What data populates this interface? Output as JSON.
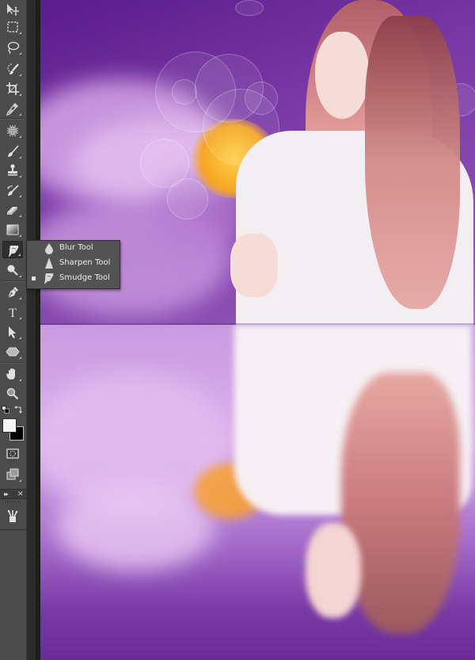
{
  "app": {
    "panel": "Tools",
    "panel_controls": {
      "collapse_glyph": "▸▸",
      "close_glyph": "✕"
    }
  },
  "tools": [
    {
      "id": "move",
      "name": "Move Tool",
      "icon": "move-icon",
      "group_more": false
    },
    {
      "id": "marquee",
      "name": "Rectangular Marquee Tool",
      "icon": "marquee-icon",
      "group_more": true
    },
    {
      "id": "lasso",
      "name": "Lasso Tool",
      "icon": "lasso-icon",
      "group_more": true
    },
    {
      "id": "quick-select",
      "name": "Quick Selection Tool",
      "icon": "quick-selection-icon",
      "group_more": true
    },
    {
      "id": "crop",
      "name": "Crop Tool",
      "icon": "crop-icon",
      "group_more": true
    },
    {
      "id": "eyedropper",
      "name": "Eyedropper Tool",
      "icon": "eyedropper-icon",
      "group_more": true
    },
    {
      "id": "healing",
      "name": "Spot Healing Brush Tool",
      "icon": "healing-brush-icon",
      "group_more": true
    },
    {
      "id": "brush",
      "name": "Brush Tool",
      "icon": "brush-icon",
      "group_more": true
    },
    {
      "id": "stamp",
      "name": "Clone Stamp Tool",
      "icon": "clone-stamp-icon",
      "group_more": true
    },
    {
      "id": "history-brush",
      "name": "History Brush Tool",
      "icon": "history-brush-icon",
      "group_more": true
    },
    {
      "id": "eraser",
      "name": "Eraser Tool",
      "icon": "eraser-icon",
      "group_more": true
    },
    {
      "id": "gradient",
      "name": "Gradient Tool",
      "icon": "gradient-icon",
      "group_more": true
    },
    {
      "id": "smudge",
      "name": "Smudge Tool",
      "icon": "smudge-icon",
      "group_more": true,
      "active": true
    },
    {
      "id": "dodge",
      "name": "Dodge Tool",
      "icon": "dodge-icon",
      "group_more": true
    },
    {
      "id": "pen",
      "name": "Pen Tool",
      "icon": "pen-icon",
      "group_more": true
    },
    {
      "id": "type",
      "name": "Horizontal Type Tool",
      "icon": "type-icon",
      "glyph": "T",
      "group_more": true
    },
    {
      "id": "path-select",
      "name": "Path Selection Tool",
      "icon": "path-selection-icon",
      "group_more": true
    },
    {
      "id": "shape",
      "name": "Custom Shape Tool",
      "icon": "polygon-shape-icon",
      "group_more": true
    },
    {
      "id": "hand",
      "name": "Hand Tool",
      "icon": "hand-icon",
      "group_more": true
    },
    {
      "id": "zoom",
      "name": "Zoom Tool",
      "icon": "zoom-icon",
      "group_more": false
    }
  ],
  "colors": {
    "foreground": "#f5f5f5",
    "background": "#000000"
  },
  "extra_tools": [
    {
      "id": "quick-mask",
      "name": "Edit in Quick Mask Mode",
      "icon": "quick-mask-icon"
    },
    {
      "id": "screen-mode",
      "name": "Change Screen Mode",
      "icon": "screen-mode-icon"
    }
  ],
  "panel_below": {
    "icon": "brushes-panel-icon",
    "name": "Brush Presets"
  },
  "flyout": {
    "items": [
      {
        "label": "Blur Tool",
        "icon": "blur-drop-icon",
        "selected": false
      },
      {
        "label": "Sharpen Tool",
        "icon": "sharpen-cone-icon",
        "selected": false
      },
      {
        "label": "Smudge Tool",
        "icon": "smudge-finger-icon",
        "selected": true
      }
    ]
  },
  "document": {
    "description": "Woman in white sweater with pink hair against purple bokeh and flower background, with water reflection",
    "palette": {
      "purple_dark": "#5b1c8c",
      "purple_light": "#c79ae0",
      "petal_pink": "#e2b4ea",
      "stamen_orange": "#f5a623",
      "sweater": "#f3eef2",
      "hair": "#c97a7e"
    }
  }
}
